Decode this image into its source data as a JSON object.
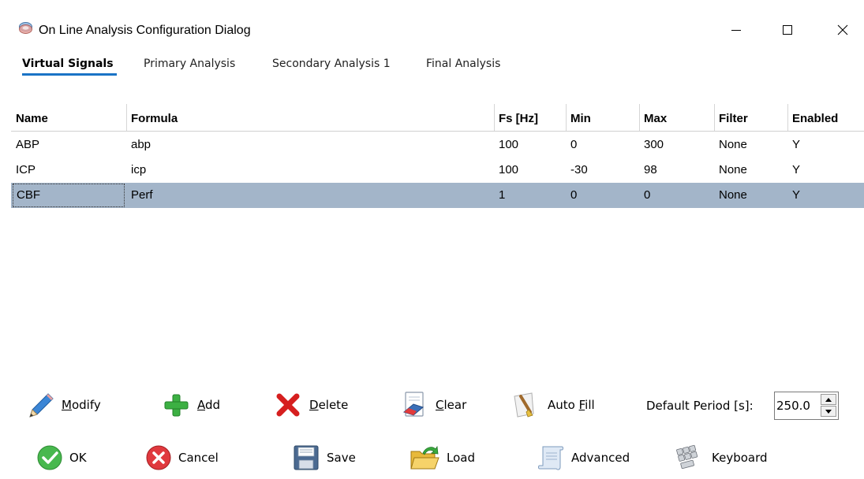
{
  "window": {
    "title": "On Line Analysis Configuration Dialog",
    "minimize_glyph": "—",
    "maximize_glyph": "☐",
    "close_glyph": "✕"
  },
  "tabs": [
    {
      "label": "Virtual Signals",
      "active": true
    },
    {
      "label": "Primary Analysis",
      "active": false
    },
    {
      "label": "Secondary Analysis 1",
      "active": false
    },
    {
      "label": "Final Analysis",
      "active": false
    }
  ],
  "table": {
    "columns": [
      "Name",
      "Formula",
      "Fs [Hz]",
      "Min",
      "Max",
      "Filter",
      "Enabled"
    ],
    "rows": [
      {
        "name": "ABP",
        "formula": "abp",
        "fs": "100",
        "min": "0",
        "max": "300",
        "filter": "None",
        "enabled": "Y",
        "selected": false
      },
      {
        "name": "ICP",
        "formula": "icp",
        "fs": "100",
        "min": "-30",
        "max": "98",
        "filter": "None",
        "enabled": "Y",
        "selected": false
      },
      {
        "name": "CBF",
        "formula": "Perf",
        "fs": "1",
        "min": "0",
        "max": "0",
        "filter": "None",
        "enabled": "Y",
        "selected": true
      }
    ]
  },
  "toolbar": {
    "modify": {
      "pre": "",
      "mnemonic": "M",
      "post": "odify",
      "icon": "pencil-icon"
    },
    "add": {
      "pre": "",
      "mnemonic": "A",
      "post": "dd",
      "icon": "plus-icon"
    },
    "delete": {
      "pre": "",
      "mnemonic": "D",
      "post": "elete",
      "icon": "red-x-icon"
    },
    "clear": {
      "pre": "",
      "mnemonic": "C",
      "post": "lear",
      "icon": "eraser-icon"
    },
    "auto_fill": {
      "pre": "Auto ",
      "mnemonic": "F",
      "post": "ill",
      "icon": "brush-icon"
    },
    "default_period_label": "Default Period [s]:",
    "default_period_value": "250.0"
  },
  "actions": {
    "ok": {
      "label": "OK",
      "icon": "green-check-icon"
    },
    "cancel": {
      "label": "Cancel",
      "icon": "red-cancel-icon"
    },
    "save": {
      "label": "Save",
      "icon": "floppy-icon"
    },
    "load": {
      "label": "Load",
      "icon": "folder-open-icon"
    },
    "advanced": {
      "label": "Advanced",
      "icon": "scroll-icon"
    },
    "keyboard": {
      "label": "Keyboard",
      "icon": "keyboard-icon"
    }
  },
  "colors": {
    "tab_underline": "#1a73c6",
    "selected_row": "#a3b5c9"
  }
}
